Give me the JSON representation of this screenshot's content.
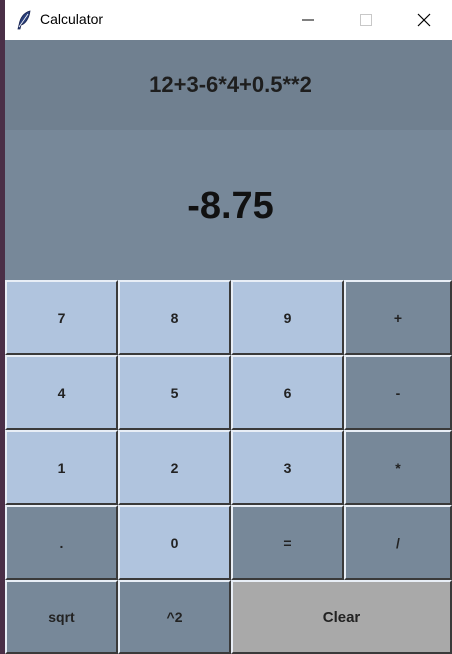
{
  "window": {
    "title": "Calculator"
  },
  "display": {
    "expression": "12+3-6*4+0.5**2",
    "result": "-8.75"
  },
  "keys": {
    "k7": "7",
    "k8": "8",
    "k9": "9",
    "plus": "+",
    "k4": "4",
    "k5": "5",
    "k6": "6",
    "minus": "-",
    "k1": "1",
    "k2": "2",
    "k3": "3",
    "multiply": "*",
    "dot": ".",
    "k0": "0",
    "equals": "=",
    "divide": "/",
    "sqrt": "sqrt",
    "square": "^2",
    "clear": "Clear"
  },
  "colors": {
    "number_key": "#b0c4de",
    "operator_key": "#778899",
    "clear_key": "#a9a9a9",
    "expression_bg": "#708090",
    "result_bg": "#778899"
  },
  "icons": {
    "app": "feather-icon",
    "minimize": "minimize-icon",
    "maximize": "maximize-icon",
    "close": "close-icon"
  }
}
